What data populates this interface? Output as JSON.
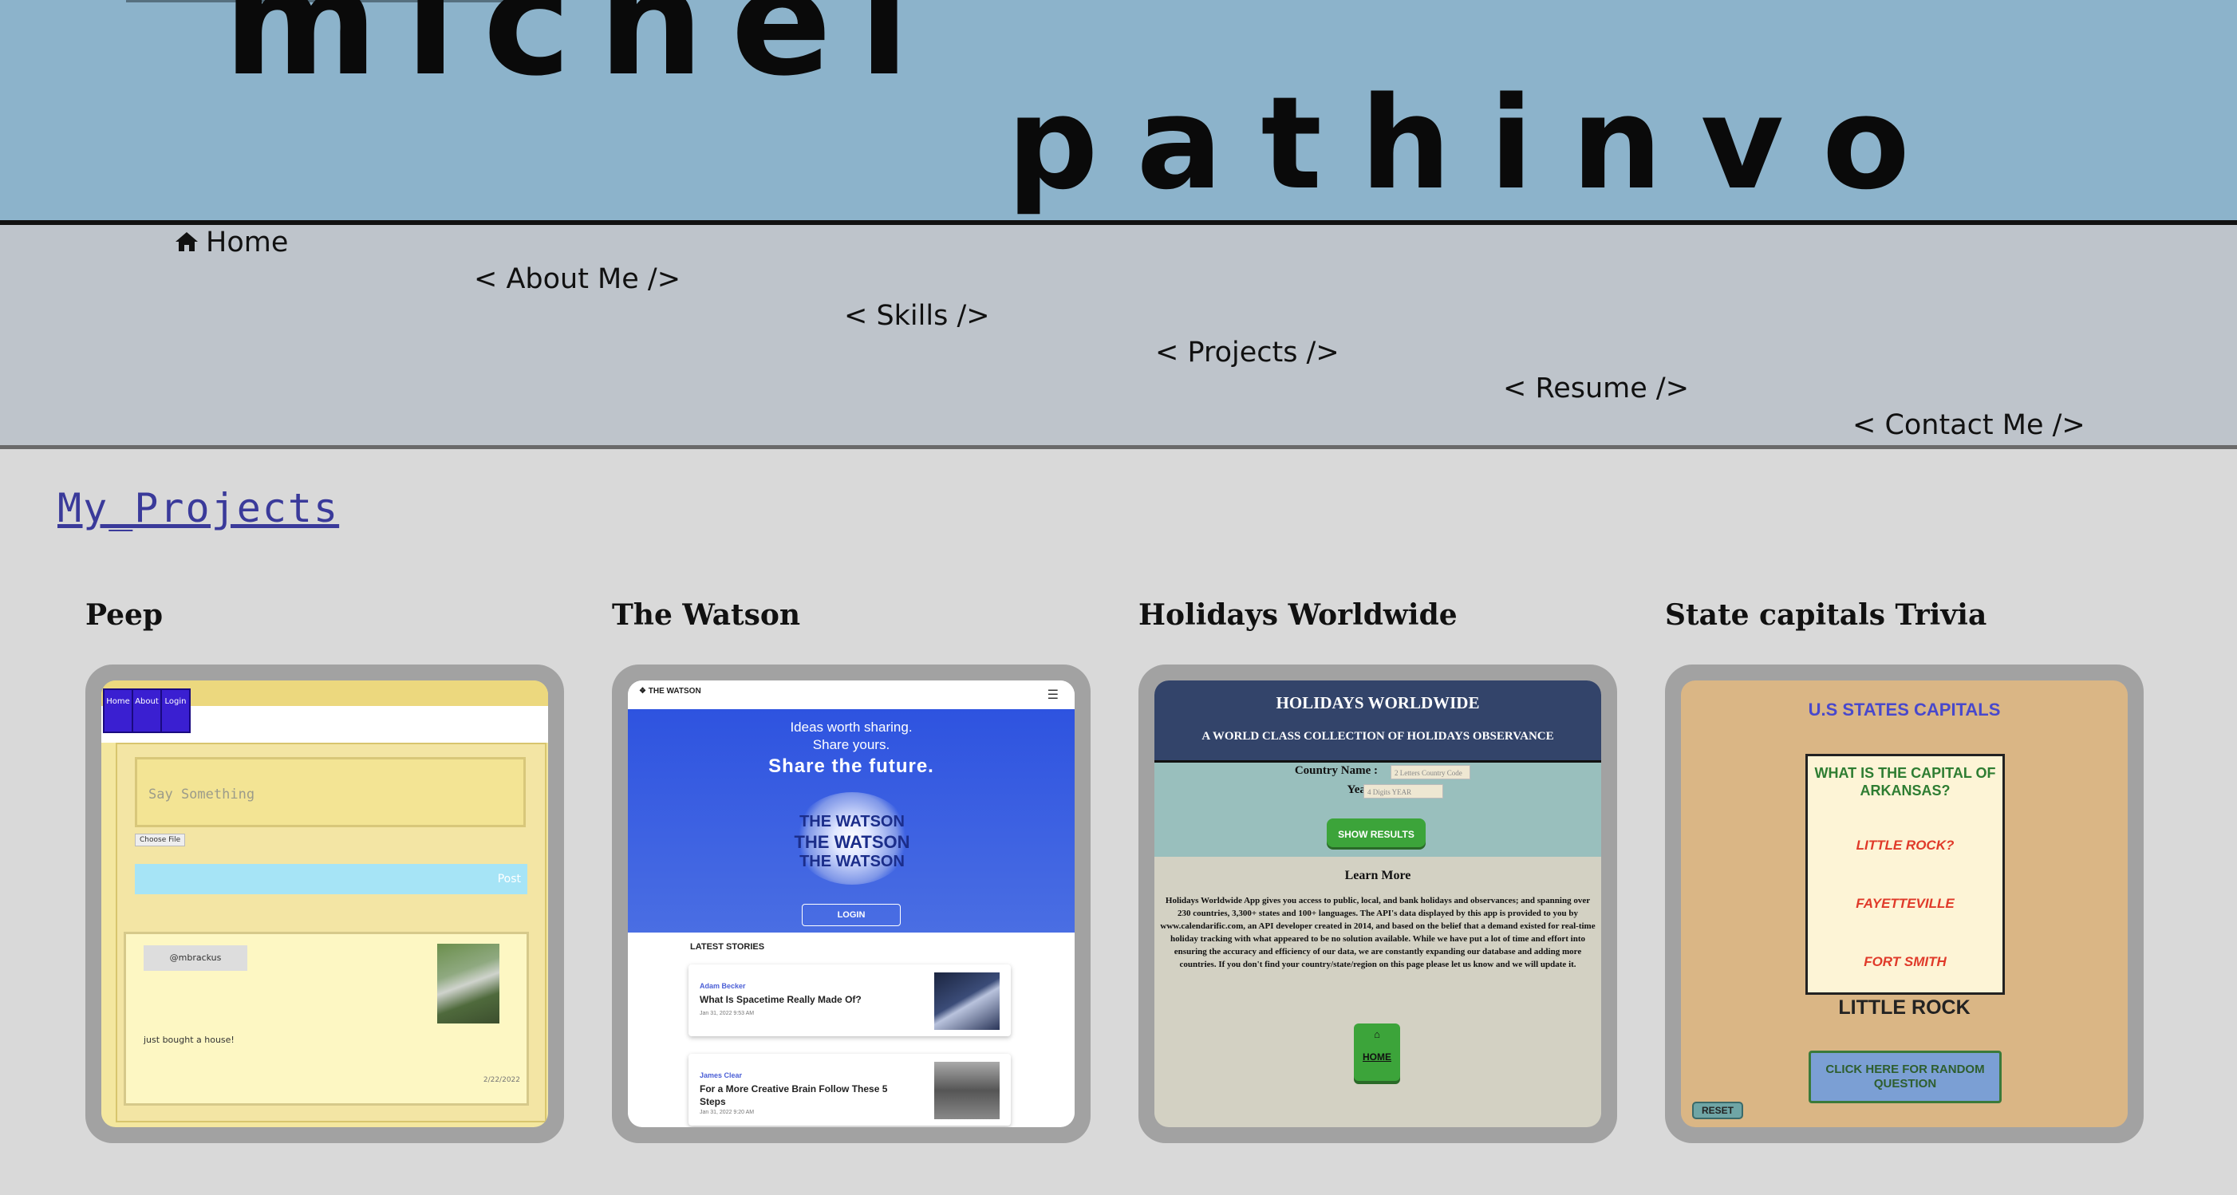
{
  "header": {
    "first_name": "michel",
    "last_name": "pathinvo"
  },
  "nav": {
    "home": "Home",
    "about": "< About Me />",
    "skills": "< Skills />",
    "projects": "< Projects />",
    "resume": "< Resume />",
    "contact": "< Contact Me />"
  },
  "section": {
    "title": "My_Projects"
  },
  "projects": [
    {
      "title": "Peep",
      "preview": {
        "nav_buttons": [
          "Home",
          "About",
          "Login"
        ],
        "placeholder": "Say Something",
        "choose_file": "Choose File",
        "post_button": "Post",
        "username": "@mbrackus",
        "post_text": "just bought a house!",
        "post_date": "2/22/2022"
      }
    },
    {
      "title": "The Watson",
      "preview": {
        "logo": "THE WATSON",
        "tagline_1": "Ideas worth sharing.",
        "tagline_2": "Share yours.",
        "headline": "Share the future.",
        "globe_text": "THE WATSON",
        "login": "LOGIN",
        "latest": "LATEST STORIES",
        "stories": [
          {
            "author": "Adam Becker",
            "title": "What Is Spacetime Really Made Of?",
            "date": "Jan 31, 2022 9:53 AM"
          },
          {
            "author": "James Clear",
            "title": "For a More Creative Brain Follow These 5 Steps",
            "date": "Jan 31, 2022 9:20 AM"
          }
        ]
      }
    },
    {
      "title": "Holidays Worldwide",
      "preview": {
        "heading": "HOLIDAYS WORLDWIDE",
        "subheading": "A WORLD CLASS COLLECTION OF HOLIDAYS OBSERVANCE",
        "country_label": "Country Name :",
        "country_placeholder": "2 Letters Country Code",
        "year_label": "Year :",
        "year_placeholder": "4 Digits YEAR",
        "show_results": "SHOW RESULTS",
        "learn_more": "Learn More",
        "description": "Holidays Worldwide App gives you access to public, local, and bank holidays and observances; and spanning over 230 countries, 3,300+ states and 100+ languages. The API's data displayed by this app is provided to you by www.calendarific.com, an API developer created in 2014, and based on the belief that a demand existed for real-time holiday tracking with what appeared to be no solution available. While we have put a lot of time and effort into ensuring the accuracy and efficiency of our data, we are constantly expanding our database and adding more countries. If you don't find your country/state/region on this page please let us know and we will update it.",
        "home_button": "HOME"
      }
    },
    {
      "title": "State capitals Trivia",
      "preview": {
        "heading": "U.S STATES CAPITALS",
        "question": "WHAT IS THE CAPITAL OF ARKANSAS?",
        "answers": [
          "LITTLE ROCK?",
          "FAYETTEVILLE",
          "FORT SMITH"
        ],
        "correct_answer": "LITTLE ROCK",
        "random_button": "CLICK HERE FOR RANDOM QUESTION",
        "reset_button": "RESET"
      }
    }
  ]
}
